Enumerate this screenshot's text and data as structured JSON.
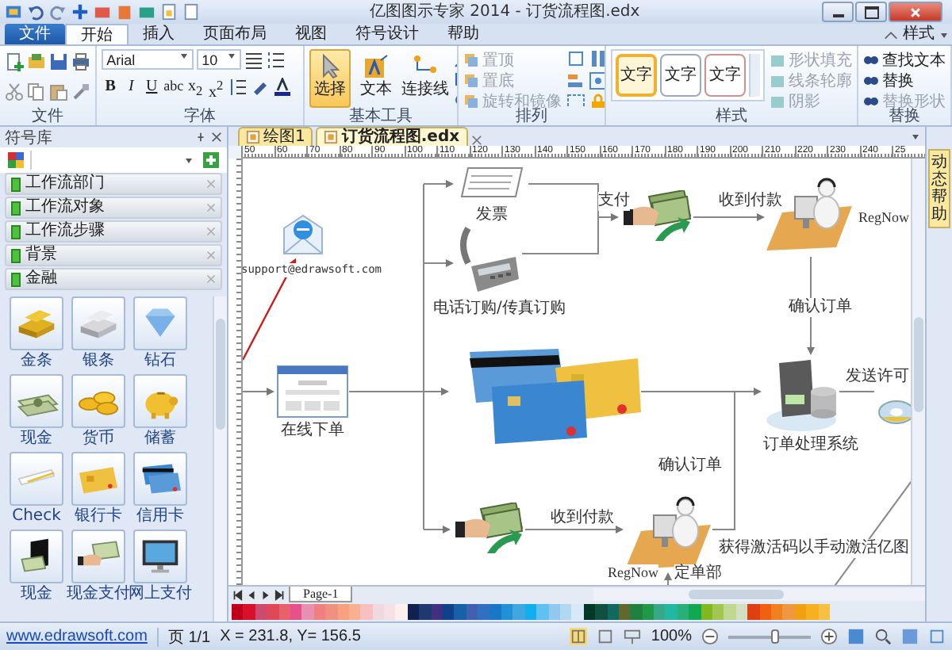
{
  "window": {
    "title": "亿图图示专家 2014 - 订货流程图.edx"
  },
  "menu_tabs": [
    {
      "label": "文件",
      "kind": "app",
      "selected": false
    },
    {
      "label": "开始",
      "kind": "tab",
      "selected": true
    },
    {
      "label": "插入",
      "kind": "tab",
      "selected": false
    },
    {
      "label": "页面布局",
      "kind": "tab",
      "selected": false
    },
    {
      "label": "视图",
      "kind": "tab",
      "selected": false
    },
    {
      "label": "符号设计",
      "kind": "tab",
      "selected": false
    },
    {
      "label": "帮助",
      "kind": "tab",
      "selected": false
    }
  ],
  "style_menu": {
    "label": "样式"
  },
  "file_group": {
    "title": "文件"
  },
  "font_group": {
    "title": "字体",
    "font_family": "Arial",
    "font_size": "10",
    "format_buttons": [
      "B",
      "I",
      "U",
      "abc",
      "x$_{2}$",
      "x$^{2}$"
    ]
  },
  "tools_group": {
    "title": "基本工具",
    "tools": [
      {
        "label": "选择",
        "kind": "pointer",
        "selected": true
      },
      {
        "label": "文本",
        "kind": "text",
        "selected": false
      },
      {
        "label": "连接线",
        "kind": "connector",
        "selected": false
      }
    ]
  },
  "arrange_group": {
    "title": "排列",
    "items": [
      {
        "label": "置顶",
        "disabled": true
      },
      {
        "label": "置底",
        "disabled": true
      },
      {
        "label": "旋转和镜像",
        "disabled": true
      }
    ]
  },
  "style_group": {
    "title": "样式",
    "presets": [
      {
        "label": "文字",
        "selected": true
      },
      {
        "label": "文字",
        "selected": false
      },
      {
        "label": "文字",
        "selected": false
      }
    ],
    "items": [
      {
        "label": "形状填充",
        "disabled": true
      },
      {
        "label": "线条轮廓",
        "disabled": true
      },
      {
        "label": "阴影",
        "disabled": true
      }
    ]
  },
  "replace_group": {
    "title": "替换",
    "items": [
      {
        "label": "查找文本",
        "disabled": false
      },
      {
        "label": "替换",
        "disabled": false
      },
      {
        "label": "替换形状",
        "disabled": true
      }
    ]
  },
  "library": {
    "title": "符号库",
    "categories": [
      "工作流部门",
      "工作流对象",
      "工作流步骤",
      "背景",
      "金融"
    ],
    "symbols": [
      {
        "label": "金条",
        "kind": "gold"
      },
      {
        "label": "银条",
        "kind": "silver"
      },
      {
        "label": "钻石",
        "kind": "diamond"
      },
      {
        "label": "现金",
        "kind": "cash"
      },
      {
        "label": "货币",
        "kind": "coins"
      },
      {
        "label": "储蓄",
        "kind": "piggy"
      },
      {
        "label": "Check",
        "kind": "check"
      },
      {
        "label": "银行卡",
        "kind": "bankcard"
      },
      {
        "label": "信用卡",
        "kind": "creditcard"
      },
      {
        "label": "现金",
        "kind": "wallet"
      },
      {
        "label": "现金支付",
        "kind": "handcash"
      },
      {
        "label": "网上支付",
        "kind": "online"
      }
    ]
  },
  "document_tabs": [
    {
      "label": "绘图1",
      "selected": false
    },
    {
      "label": "订货流程图.edx",
      "selected": true
    }
  ],
  "ruler_labels": [
    "50",
    "60",
    "70",
    "80",
    "90",
    "100",
    "110",
    "120",
    "130",
    "140",
    "150",
    "160",
    "170",
    "180",
    "190",
    "200",
    "210",
    "220",
    "230",
    "240",
    "25"
  ],
  "canvas": {
    "nodes": [
      {
        "kind": "email",
        "label": "support@edrawsoft.com"
      },
      {
        "kind": "invoice",
        "label": "发票"
      },
      {
        "kind": "phone",
        "label": "电话订购/传真订购"
      },
      {
        "kind": "payment"
      },
      {
        "kind": "agent"
      },
      {
        "kind": "server",
        "label": "订单处理系统"
      },
      {
        "kind": "disc"
      },
      {
        "kind": "browser",
        "label": "在线下单"
      },
      {
        "kind": "cards"
      },
      {
        "kind": "payment"
      },
      {
        "kind": "agent"
      }
    ],
    "labels": [
      "支付",
      "收到付款",
      "RegNow",
      "确认订单",
      "发送许可",
      "确认订单",
      "收到付款",
      "获得激活码以手动激活亿图",
      "RegNow",
      "定单部"
    ]
  },
  "page_tab": {
    "label": "Page-1"
  },
  "help_panel": {
    "label": "动态帮助"
  },
  "palette": [
    {
      "color": "#c0001a"
    },
    {
      "color": "#d8102c"
    },
    {
      "color": "#cc4a6e"
    },
    {
      "color": "#e04858"
    },
    {
      "color": "#e8606a"
    },
    {
      "color": "#e8508c"
    },
    {
      "color": "#e890b0"
    },
    {
      "color": "#f08080"
    },
    {
      "color": "#f09080"
    },
    {
      "color": "#f8a080"
    },
    {
      "color": "#f8b090"
    },
    {
      "color": "#f8c0c0"
    },
    {
      "color": "#f0d8e0"
    },
    {
      "color": "#f8e0e8"
    },
    {
      "color": "#fff0f0"
    },
    {
      "color": "#102050"
    },
    {
      "color": "#203870"
    },
    {
      "color": "#403080"
    },
    {
      "color": "#10408c"
    },
    {
      "color": "#1860a8"
    },
    {
      "color": "#4060b0"
    },
    {
      "color": "#3070c0"
    },
    {
      "color": "#1878c8"
    },
    {
      "color": "#2090d8"
    },
    {
      "color": "#40a8e0"
    },
    {
      "color": "#10b0f0"
    },
    {
      "color": "#60c0f0"
    },
    {
      "color": "#90c8f0"
    },
    {
      "color": "#b0d8f0"
    },
    {
      "color": "#d8e8f8"
    },
    {
      "color": "#003828"
    },
    {
      "color": "#105040"
    },
    {
      "color": "#106860"
    },
    {
      "color": "#606830"
    },
    {
      "color": "#208040"
    },
    {
      "color": "#209848"
    },
    {
      "color": "#38a888"
    },
    {
      "color": "#20b8a0"
    },
    {
      "color": "#28b078"
    },
    {
      "color": "#10a850"
    },
    {
      "color": "#80b820"
    },
    {
      "color": "#a0c850"
    },
    {
      "color": "#c0d890"
    },
    {
      "color": "#d0e0c0"
    },
    {
      "color": "#e04010"
    },
    {
      "color": "#f06010"
    },
    {
      "color": "#f08020"
    },
    {
      "color": "#f09840"
    },
    {
      "color": "#f0a010"
    },
    {
      "color": "#f8b020"
    },
    {
      "color": "#f8c040"
    }
  ],
  "status_bar": {
    "link": "www.edrawsoft.com",
    "page": "页 1/1",
    "coordinates": "X = 231.8, Y= 156.5",
    "zoom": "100%",
    "zoom_slider": {
      "level": 0.55
    }
  }
}
